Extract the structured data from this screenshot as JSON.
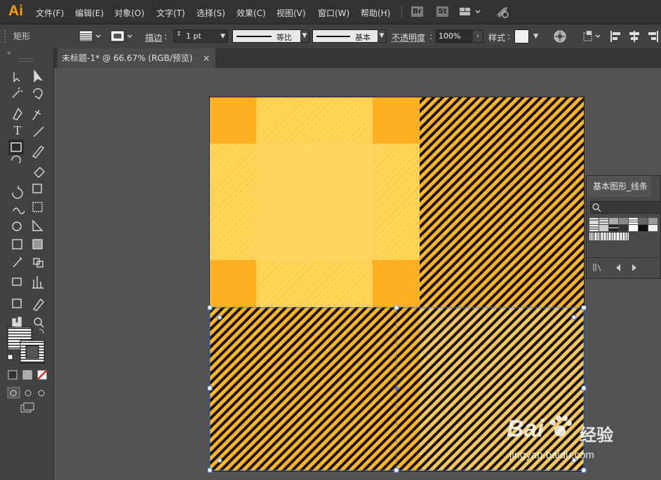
{
  "app": {
    "logo": "Ai",
    "brand_color": "#ff9a00"
  },
  "menubar": {
    "items": [
      "文件(F)",
      "编辑(E)",
      "对象(O)",
      "文字(T)",
      "选择(S)",
      "效果(C)",
      "视图(V)",
      "窗口(W)",
      "帮助(H)"
    ],
    "bridge_label": "Br",
    "stock_label": "St"
  },
  "controlbar": {
    "tool_name": "矩形",
    "stroke_label": "描边",
    "stroke_weight": "1 pt",
    "profile_label": "等比",
    "brush_label": "基本",
    "opacity_label": "不透明度",
    "opacity_value": "100%",
    "style_label": "样式"
  },
  "document": {
    "tab_title": "未标题-1* @ 66.67% (RGB/预览)",
    "close": "×"
  },
  "swatch_panel": {
    "title": "基本图形_线条"
  },
  "watermark": {
    "brand": "Bai",
    "brand2": "经验",
    "url": "jingyan.baidu.com"
  },
  "colors": {
    "light_yellow": "#ffd55e",
    "orange": "#ffb020",
    "selection": "#4a7bd8",
    "stripe": "#111111"
  }
}
